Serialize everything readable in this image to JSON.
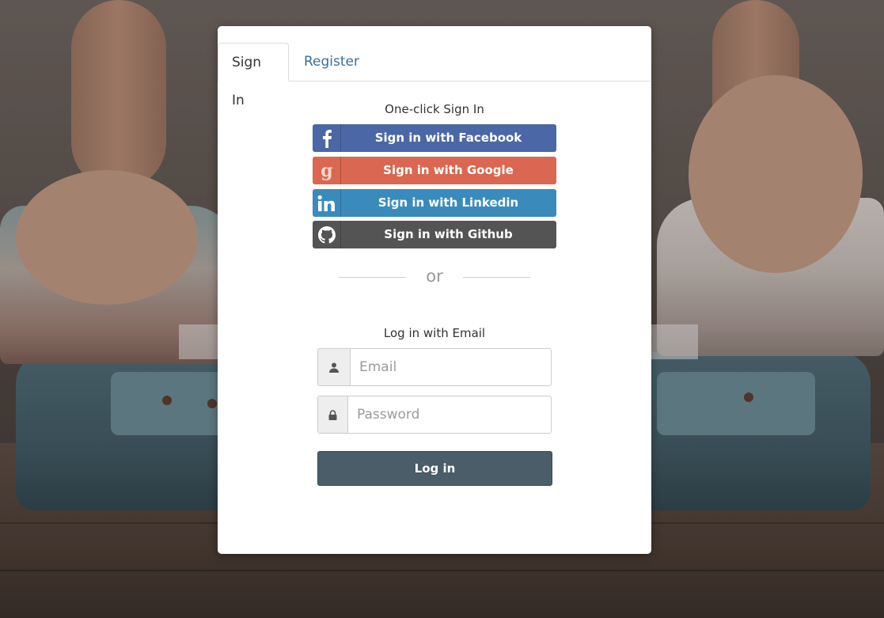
{
  "tabs": [
    {
      "label": "Sign In",
      "active": true
    },
    {
      "label": "Register",
      "active": false
    }
  ],
  "oneclick": {
    "title": "One-click Sign In",
    "buttons": [
      {
        "label": "Sign in with Facebook",
        "icon": "facebook-icon",
        "color": "#4b67a5"
      },
      {
        "label": "Sign in with Google",
        "icon": "google-icon",
        "color": "#da6751"
      },
      {
        "label": "Sign in with Linkedin",
        "icon": "linkedin-icon",
        "color": "#3a8bbb"
      },
      {
        "label": "Sign in with Github",
        "icon": "github-icon",
        "color": "#545454"
      }
    ]
  },
  "divider": {
    "text": "or"
  },
  "email_login": {
    "title": "Log in with Email",
    "email": {
      "placeholder": "Email",
      "value": "",
      "icon": "user-icon"
    },
    "password": {
      "placeholder": "Password",
      "value": "",
      "icon": "lock-icon"
    },
    "submit_label": "Log in"
  },
  "colors": {
    "primary_button": "#4a5d68",
    "tab_link": "#3a6f9a"
  }
}
